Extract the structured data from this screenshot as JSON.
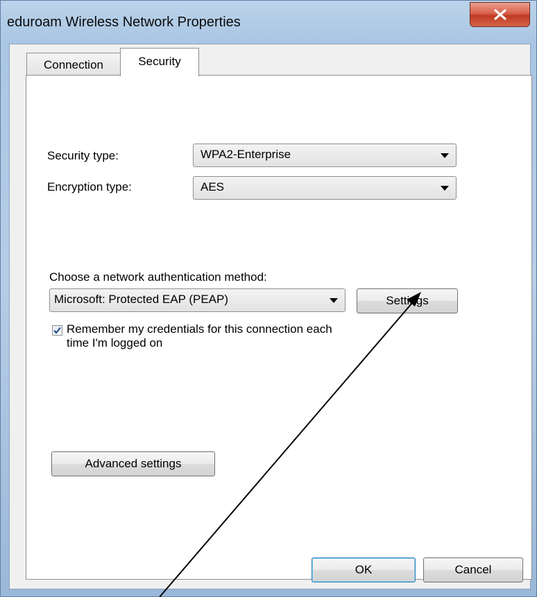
{
  "window": {
    "title": "eduroam Wireless Network Properties",
    "close_icon": "close-icon"
  },
  "tabs": [
    {
      "label": "Connection",
      "selected": false
    },
    {
      "label": "Security",
      "selected": true
    }
  ],
  "security": {
    "security_type_label": "Security type:",
    "security_type_value": "WPA2-Enterprise",
    "encryption_type_label": "Encryption type:",
    "encryption_type_value": "AES",
    "auth_method_label": "Choose a network authentication method:",
    "auth_method_value": "Microsoft: Protected EAP (PEAP)",
    "settings_label": "Settings",
    "remember_checked": true,
    "remember_line1": "Remember my credentials for this connection each",
    "remember_line2": "time I'm logged on",
    "advanced_label": "Advanced settings"
  },
  "footer": {
    "ok_label": "OK",
    "cancel_label": "Cancel"
  },
  "annotation": {
    "type": "arrow",
    "points_to": "settings-button",
    "color": "#000000"
  }
}
